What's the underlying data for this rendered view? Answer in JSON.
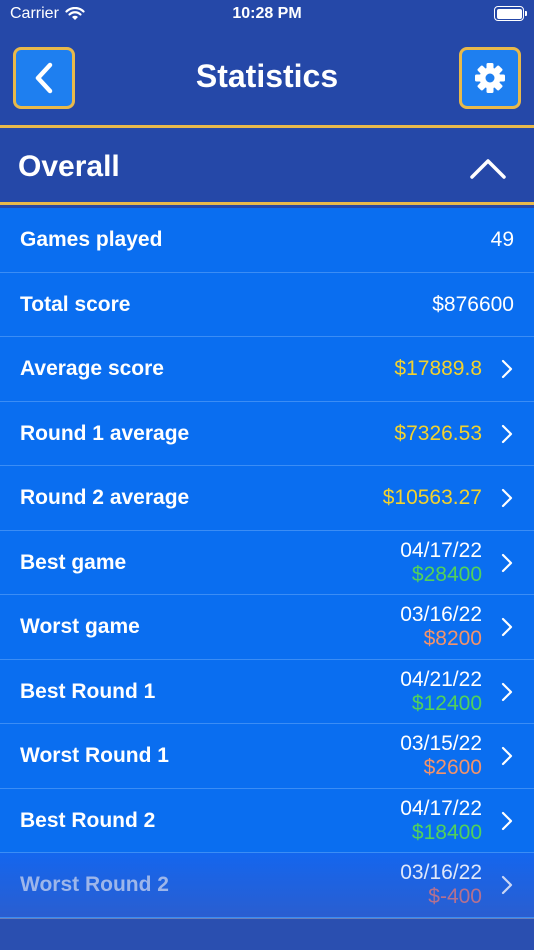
{
  "status_bar": {
    "carrier": "Carrier",
    "time": "10:28 PM"
  },
  "nav": {
    "title": "Statistics",
    "back_icon": "chevron-left-icon",
    "settings_icon": "gear-icon"
  },
  "section": {
    "title": "Overall",
    "toggle_icon": "chevron-up-icon"
  },
  "rows": {
    "games_played": {
      "label": "Games played",
      "value": "49"
    },
    "total_score": {
      "label": "Total score",
      "value": "$876600"
    },
    "average_score": {
      "label": "Average score",
      "value": "$17889.8"
    },
    "round1_average": {
      "label": "Round 1 average",
      "value": "$7326.53"
    },
    "round2_average": {
      "label": "Round 2 average",
      "value": "$10563.27"
    },
    "best_game": {
      "label": "Best game",
      "date": "04/17/22",
      "amount": "$28400"
    },
    "worst_game": {
      "label": "Worst game",
      "date": "03/16/22",
      "amount": "$8200"
    },
    "best_round1": {
      "label": "Best Round 1",
      "date": "04/21/22",
      "amount": "$12400"
    },
    "worst_round1": {
      "label": "Worst Round 1",
      "date": "03/15/22",
      "amount": "$2600"
    },
    "best_round2": {
      "label": "Best Round 2",
      "date": "04/17/22",
      "amount": "$18400"
    },
    "worst_round2": {
      "label": "Worst Round 2",
      "date": "03/16/22",
      "amount": "$-400"
    }
  },
  "colors": {
    "background": "#2548a8",
    "row": "#0a6ef0",
    "accent_border": "#e8b94a",
    "average_value": "#f2d22e",
    "best_value": "#52d15a",
    "worst_value": "#f2936b"
  }
}
